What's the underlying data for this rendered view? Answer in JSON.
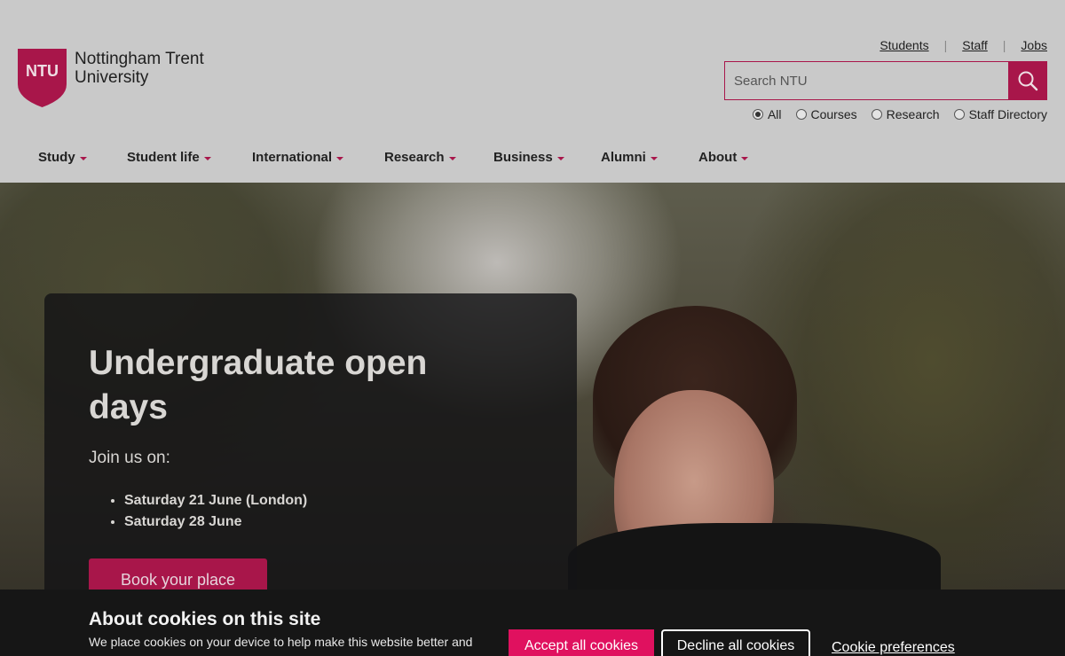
{
  "header": {
    "logo_badge": "NTU",
    "logo_line1": "Nottingham Trent",
    "logo_line2": "University",
    "brand_color": "#a8164a",
    "top_links": [
      {
        "label": "Students"
      },
      {
        "label": "Staff"
      },
      {
        "label": "Jobs"
      }
    ],
    "search": {
      "placeholder": "Search NTU",
      "value": "",
      "button_icon": "search-icon"
    },
    "scopes": [
      {
        "label": "All",
        "checked": true
      },
      {
        "label": "Courses",
        "checked": false
      },
      {
        "label": "Research",
        "checked": false
      },
      {
        "label": "Staff Directory",
        "checked": false
      }
    ]
  },
  "nav": {
    "items": [
      {
        "label": "Study"
      },
      {
        "label": "Student life"
      },
      {
        "label": "International"
      },
      {
        "label": "Research"
      },
      {
        "label": "Business"
      },
      {
        "label": "Alumni"
      },
      {
        "label": "About"
      }
    ]
  },
  "hero": {
    "title": "Undergraduate open days",
    "subtitle": "Join us on:",
    "dates": [
      "Saturday 21 June (London)",
      "Saturday 28 June"
    ],
    "cta_label": "Book your place"
  },
  "cookie_banner": {
    "title": "About cookies on this site",
    "text": "We place cookies on your device to help make this website better and",
    "accept_label": "Accept all cookies",
    "decline_label": "Decline all cookies",
    "preferences_label": "Cookie preferences",
    "accent_color": "#e0115f"
  }
}
